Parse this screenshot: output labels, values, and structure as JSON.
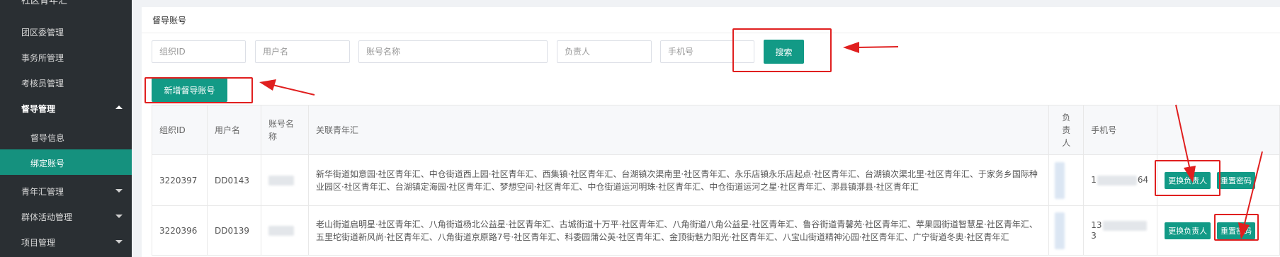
{
  "sidebar": {
    "top_label": "社区青年汇",
    "items": [
      {
        "label": "团区委管理"
      },
      {
        "label": "事务所管理"
      },
      {
        "label": "考核员管理"
      },
      {
        "label": "督导管理"
      },
      {
        "label": "督导信息"
      },
      {
        "label": "绑定账号"
      },
      {
        "label": "青年汇管理"
      },
      {
        "label": "群体活动管理"
      },
      {
        "label": "项目管理"
      }
    ]
  },
  "panel": {
    "title": "督导账号"
  },
  "search": {
    "org_id_placeholder": "组织ID",
    "username_placeholder": "用户名",
    "account_name_placeholder": "账号名称",
    "owner_placeholder": "负责人",
    "phone_placeholder": "手机号",
    "search_label": "搜索"
  },
  "add_button_label": "新增督导账号",
  "table": {
    "headers": [
      "组织ID",
      "用户名",
      "账号名称",
      "关联青年汇",
      "负责人",
      "手机号",
      ""
    ],
    "rows": [
      {
        "org_id": "3220397",
        "username": "DD0143",
        "clubs": "新华街道如意园·社区青年汇、中仓街道西上园·社区青年汇、西集镇·社区青年汇、台湖镇次渠南里·社区青年汇、永乐店镇永乐店起点·社区青年汇、台湖镇次渠北里·社区青年汇、于家务乡国际种业园区·社区青年汇、台湖镇定海园·社区青年汇、梦想空间·社区青年汇、中仓街道运河明珠·社区青年汇、中仓街道运河之星·社区青年汇、漷县镇漷县·社区青年汇",
        "phone_prefix": "1",
        "phone_suffix": "64"
      },
      {
        "org_id": "3220396",
        "username": "DD0139",
        "clubs": "老山街道启明星·社区青年汇、八角街道杨北公益星·社区青年汇、古城街道十万平·社区青年汇、八角街道八角公益星·社区青年汇、鲁谷街道青馨苑·社区青年汇、苹果园街道智慧星·社区青年汇、五里坨街道新风尚·社区青年汇、八角街道京原路7号·社区青年汇、科委园蒲公英·社区青年汇、金顶街魅力阳光·社区青年汇、八宝山街道精神沁园·社区青年汇、广宁街道冬奥·社区青年汇",
        "phone_prefix": "13",
        "phone_suffix": "3"
      }
    ],
    "change_owner_label": "更换负责人",
    "reset_password_label": "重置密码"
  },
  "colors": {
    "sidebar_bg": "#2a2f33",
    "accent": "#129a86",
    "annotation": "#e01f1f"
  }
}
